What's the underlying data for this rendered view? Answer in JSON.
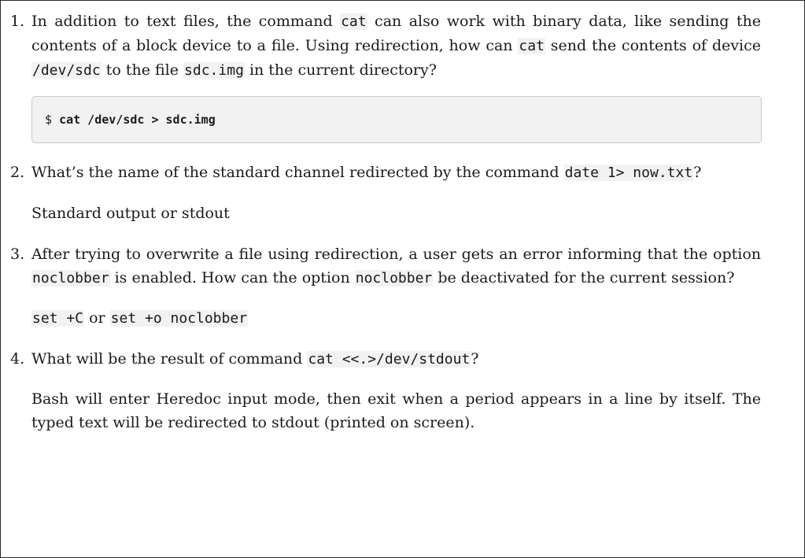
{
  "questions": [
    {
      "number": "1.",
      "prompt": {
        "t1": "In addition to text files, the command ",
        "c1": "cat",
        "t2": " can also work with binary data, like sending the contents of a block device to a file. Using redirection, how can ",
        "c2": "cat",
        "t3": " send the contents of device ",
        "c3": "/dev/sdc",
        "t4": " to the file ",
        "c4": "sdc.img",
        "t5": " in the current directory?"
      },
      "answer_code": {
        "prompt_symbol": "$",
        "command": "cat /dev/sdc > sdc.img"
      }
    },
    {
      "number": "2.",
      "prompt": {
        "t1": "What’s the name of the standard channel redirected by the command ",
        "c1": "date 1> now.txt",
        "t2": "?"
      },
      "answer": "Standard output or stdout"
    },
    {
      "number": "3.",
      "prompt": {
        "t1": "After trying to overwrite a file using redirection, a user gets an error informing that the option ",
        "c1": "noclobber",
        "t2": " is enabled. How can the option ",
        "c2": "noclobber",
        "t3": " be deactivated for the current session?"
      },
      "answer": {
        "c1": "set +C",
        "t1": " or ",
        "c2": "set +o noclobber"
      }
    },
    {
      "number": "4.",
      "prompt": {
        "t1": "What will be the result of command ",
        "c1": "cat <<.>/dev/stdout",
        "t2": "?"
      },
      "answer": "Bash will enter Heredoc input mode, then exit when a period appears in a line by itself. The typed text will be redirected to stdout (printed on screen)."
    }
  ]
}
